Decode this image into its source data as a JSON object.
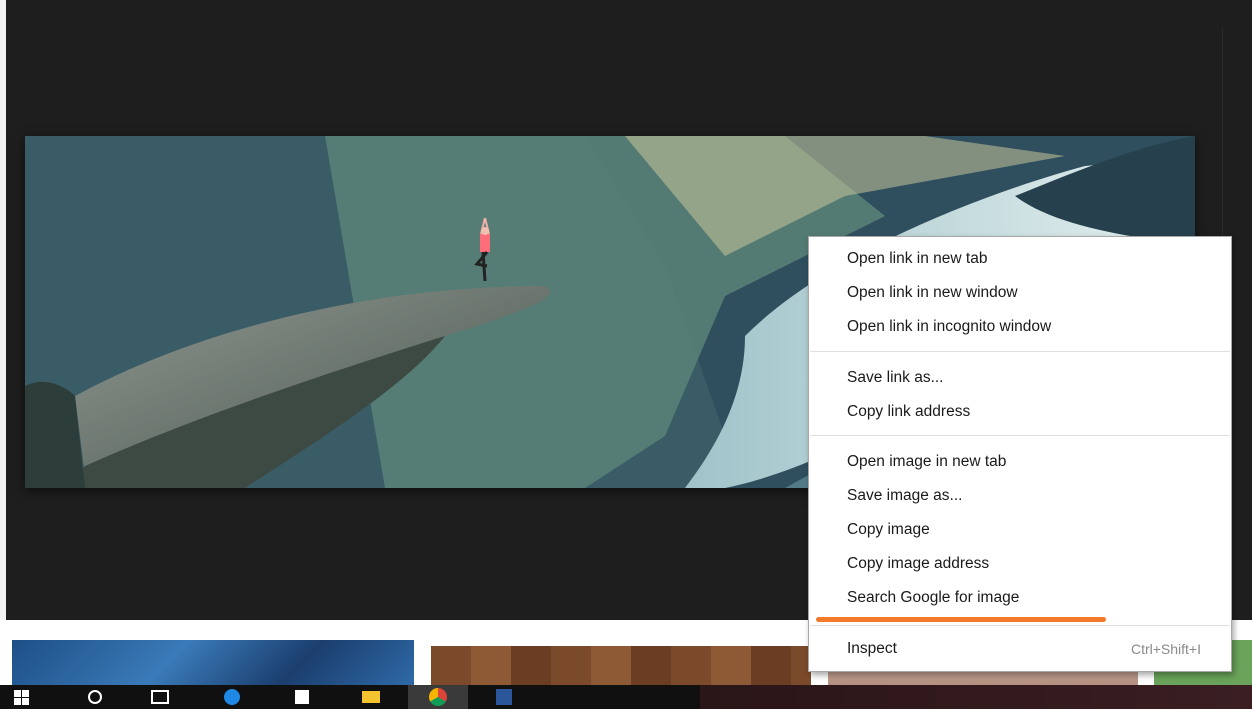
{
  "context_menu": {
    "items": [
      {
        "label": "Open link in new tab"
      },
      {
        "label": "Open link in new window"
      },
      {
        "label": "Open link in incognito window"
      },
      {
        "label": "Save link as..."
      },
      {
        "label": "Copy link address"
      },
      {
        "label": "Open image in new tab"
      },
      {
        "label": "Save image as..."
      },
      {
        "label": "Copy image"
      },
      {
        "label": "Copy image address"
      },
      {
        "label": "Search Google for image"
      },
      {
        "label": "Inspect",
        "shortcut": "Ctrl+Shift+I"
      }
    ]
  },
  "highlight": {
    "color": "#f37a2a"
  },
  "taskbar": {
    "icons": [
      "windows-start-icon",
      "search-icon",
      "task-view-icon",
      "edge-icon",
      "store-icon",
      "file-explorer-icon",
      "chrome-icon",
      "word-icon"
    ]
  }
}
